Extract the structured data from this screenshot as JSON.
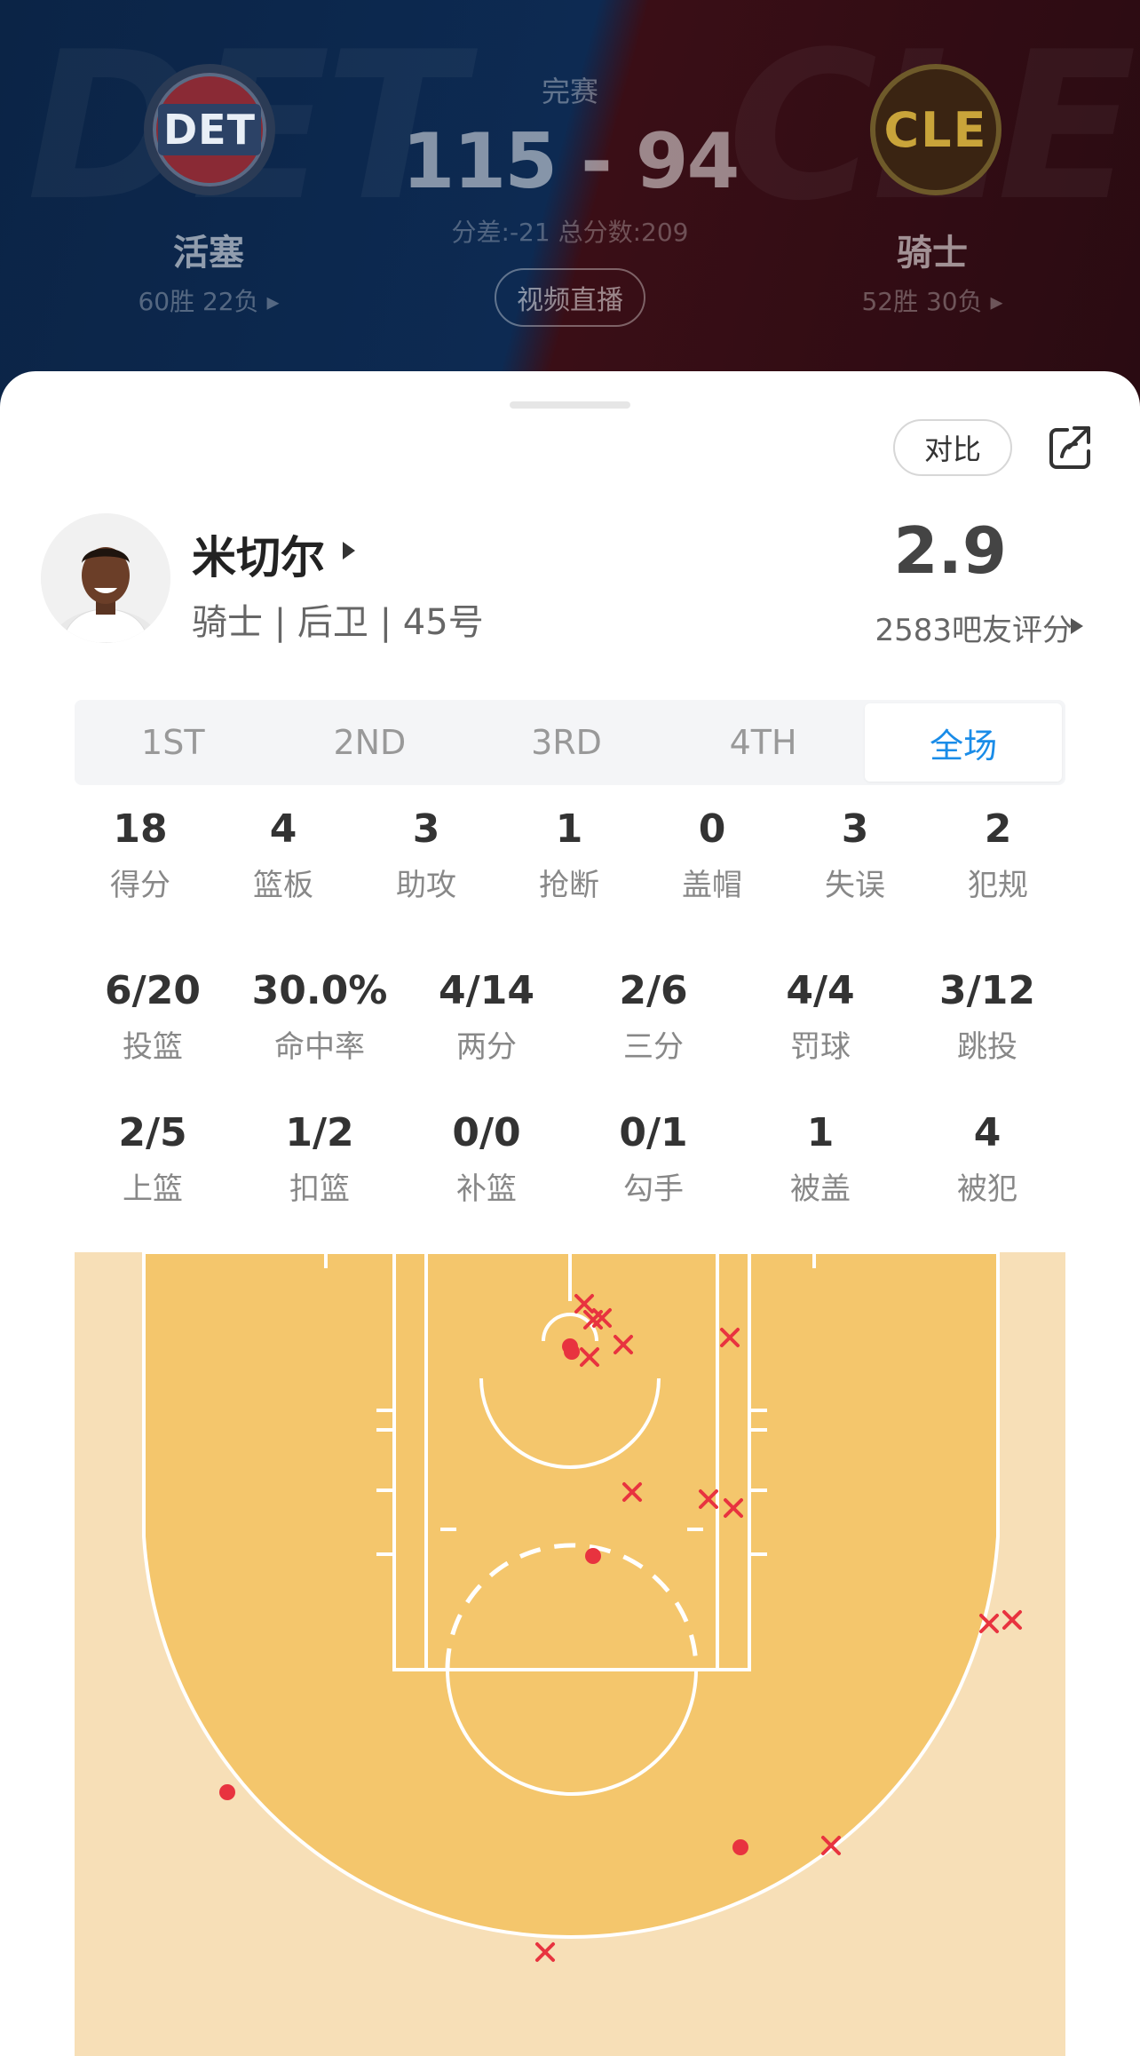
{
  "game": {
    "status": "完赛",
    "score": "115 - 94",
    "meta": "分差:-21 总分数:209",
    "live_button": "视频直播",
    "home": {
      "abbr": "DET",
      "name": "活塞",
      "record": "60胜 22负 ▸",
      "color": "#c8102e"
    },
    "away": {
      "abbr": "CLE",
      "name": "骑士",
      "record": "52胜 30负 ▸",
      "color": "#860038"
    }
  },
  "actions": {
    "compare_label": "对比",
    "share_icon": "share-icon"
  },
  "player": {
    "name": "米切尔",
    "info": "骑士 | 后卫 | 45号",
    "rating": "2.9",
    "rating_count": "2583吧友评分"
  },
  "tabs": [
    "1ST",
    "2ND",
    "3RD",
    "4TH",
    "全场"
  ],
  "active_tab": "全场",
  "stats_row1": [
    {
      "value": "18",
      "label": "得分"
    },
    {
      "value": "4",
      "label": "篮板"
    },
    {
      "value": "3",
      "label": "助攻"
    },
    {
      "value": "1",
      "label": "抢断"
    },
    {
      "value": "0",
      "label": "盖帽"
    },
    {
      "value": "3",
      "label": "失误"
    },
    {
      "value": "2",
      "label": "犯规"
    }
  ],
  "stats_row2": [
    {
      "value": "6/20",
      "label": "投篮"
    },
    {
      "value": "30.0%",
      "label": "命中率"
    },
    {
      "value": "4/14",
      "label": "两分"
    },
    {
      "value": "2/6",
      "label": "三分"
    },
    {
      "value": "4/4",
      "label": "罚球"
    },
    {
      "value": "3/12",
      "label": "跳投"
    }
  ],
  "stats_row3": [
    {
      "value": "2/5",
      "label": "上篮"
    },
    {
      "value": "1/2",
      "label": "扣篮"
    },
    {
      "value": "0/0",
      "label": "补篮"
    },
    {
      "value": "0/1",
      "label": "勾手"
    },
    {
      "value": "1",
      "label": "被盖"
    },
    {
      "value": "4",
      "label": "被犯"
    }
  ],
  "shot_chart": {
    "make_color": "#e8333f",
    "miss_color": "#e8333f",
    "court_colors": {
      "paint_area": "#f4c66c",
      "outside": "#f7dfb7",
      "lines": "#ffffff"
    }
  }
}
